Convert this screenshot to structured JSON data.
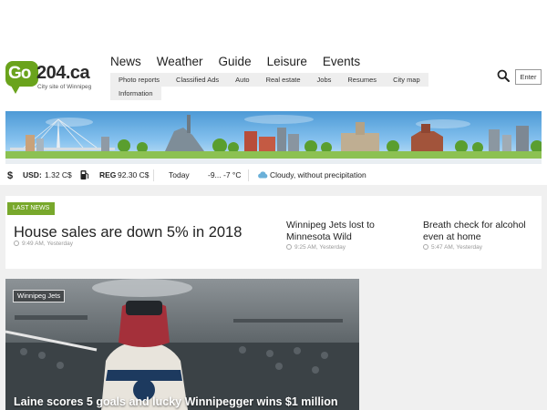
{
  "logo": {
    "name_go": "Go",
    "name_rest": "204.ca",
    "tagline": "City site of Winnipeg"
  },
  "main_nav": [
    "News",
    "Weather",
    "Guide",
    "Leisure",
    "Events"
  ],
  "sub_nav_row1": [
    "Photo reports",
    "Classified Ads",
    "Auto",
    "Real estate",
    "Jobs",
    "Resumes",
    "City map"
  ],
  "sub_nav_row2": [
    "Information"
  ],
  "header_actions": {
    "enter_label": "Enter"
  },
  "info_bar": {
    "usd_label": "USD:",
    "usd_value": "1.32 C$",
    "reg_label": "REG",
    "reg_value": "92.30 C$",
    "today_label": "Today",
    "temperature": "-9... -7 °C",
    "weather_text": "Cloudy, without precipitation"
  },
  "news": {
    "badge": "LAST NEWS",
    "main": {
      "title": "House sales are down 5% in 2018",
      "time": "9:49 AM, Yesterday"
    },
    "side": [
      {
        "title": "Winnipeg Jets lost to Minnesota Wild",
        "time": "9:25 AM, Yesterday"
      },
      {
        "title": "Breath check for alcohol even at home",
        "time": "5:47 AM, Yesterday"
      }
    ]
  },
  "featured": {
    "tag": "Winnipeg Jets",
    "title": "Laine scores 5 goals and lucky Winnipegger wins $1 million"
  },
  "colors": {
    "brand_green": "#6aa31c",
    "badge_green": "#78a82c",
    "nav_pill_bg": "#eeeeee",
    "page_gray": "#f0f0f0"
  },
  "icons": [
    "search-icon",
    "dollar-icon",
    "fuel-pump-icon",
    "cloud-icon",
    "clock-icon"
  ]
}
